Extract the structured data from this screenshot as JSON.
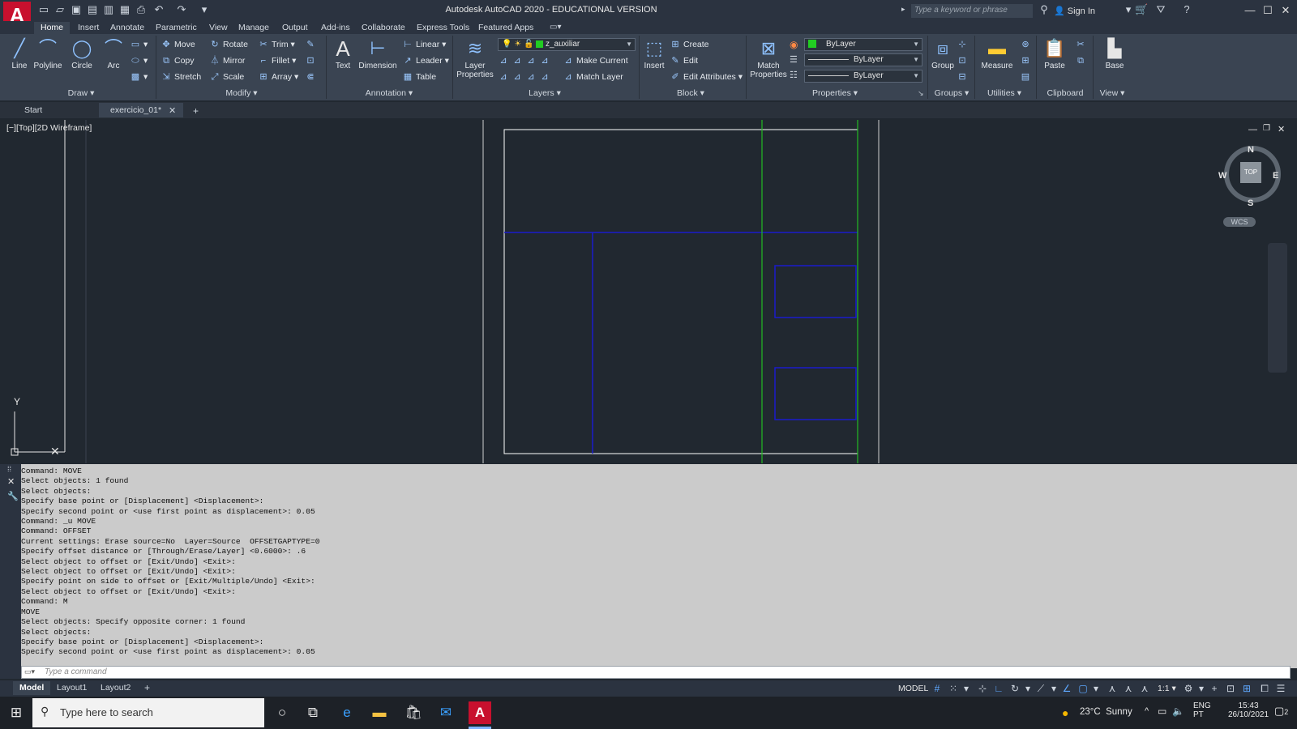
{
  "app": {
    "logo_letter": "A",
    "title": "Autodesk AutoCAD 2020 - EDUCATIONAL VERSION",
    "search_placeholder": "Type a keyword or phrase",
    "sign_in": "Sign In"
  },
  "ribbon_tabs": [
    "Home",
    "Insert",
    "Annotate",
    "Parametric",
    "View",
    "Manage",
    "Output",
    "Add-ins",
    "Collaborate",
    "Express Tools",
    "Featured Apps"
  ],
  "draw": {
    "label": "Draw",
    "line": "Line",
    "polyline": "Polyline",
    "circle": "Circle",
    "arc": "Arc"
  },
  "modify": {
    "label": "Modify",
    "move": "Move",
    "rotate": "Rotate",
    "trim": "Trim",
    "copy": "Copy",
    "mirror": "Mirror",
    "fillet": "Fillet",
    "stretch": "Stretch",
    "scale": "Scale",
    "array": "Array"
  },
  "annotation": {
    "label": "Annotation",
    "text": "Text",
    "dimension": "Dimension",
    "linear": "Linear",
    "leader": "Leader",
    "table": "Table"
  },
  "layers": {
    "label": "Layers",
    "layer_properties_1": "Layer",
    "layer_properties_2": "Properties",
    "current_layer": "z_auxiliar",
    "make_current": "Make Current",
    "match_layer": "Match Layer"
  },
  "block": {
    "label": "Block",
    "insert": "Insert",
    "create": "Create",
    "edit": "Edit",
    "edit_attributes": "Edit Attributes"
  },
  "properties": {
    "label": "Properties",
    "match_1": "Match",
    "match_2": "Properties",
    "color": "ByLayer",
    "linetype": "ByLayer",
    "lineweight": "ByLayer"
  },
  "groups": {
    "label": "Groups",
    "group": "Group"
  },
  "utilities": {
    "label": "Utilities",
    "measure": "Measure"
  },
  "clipboard": {
    "label": "Clipboard",
    "paste": "Paste"
  },
  "view": {
    "label": "View",
    "base": "Base"
  },
  "doc_tabs": {
    "start": "Start",
    "active": "exercicio_01*"
  },
  "viewport": {
    "label": "[−][Top][2D Wireframe]",
    "compass": {
      "n": "N",
      "s": "S",
      "e": "E",
      "w": "W",
      "top": "TOP"
    },
    "wcs": "WCS",
    "ucs_y": "Y"
  },
  "command_history": [
    "Command: MOVE",
    "Select objects: 1 found",
    "Select objects:",
    "Specify base point or [Displacement] <Displacement>:",
    "Specify second point or <use first point as displacement>: 0.05",
    "Command: _u MOVE",
    "Command: OFFSET",
    "Current settings: Erase source=No  Layer=Source  OFFSETGAPTYPE=0",
    "Specify offset distance or [Through/Erase/Layer] <0.6000>: .6",
    "Select object to offset or [Exit/Undo] <Exit>:",
    "Select object to offset or [Exit/Undo] <Exit>:",
    "Specify point on side to offset or [Exit/Multiple/Undo] <Exit>:",
    "Select object to offset or [Exit/Undo] <Exit>:",
    "Command: M",
    "MOVE",
    "Select objects: Specify opposite corner: 1 found",
    "Select objects:",
    "Specify base point or [Displacement] <Displacement>:",
    "Specify second point or <use first point as displacement>: 0.05"
  ],
  "command_placeholder": "Type a command",
  "layout_tabs": [
    "Model",
    "Layout1",
    "Layout2"
  ],
  "status": {
    "model": "MODEL",
    "scale": "1:1"
  },
  "taskbar": {
    "search": "Type here to search",
    "weather": "23°C  Sunny",
    "lang_1": "ENG",
    "lang_2": "PT",
    "time": "15:43",
    "date": "26/10/2021",
    "notifications": "2"
  },
  "colors": {
    "accent": "#c8102e",
    "layer_green": "#22cc22",
    "blue_lines": "#1a1acc",
    "green_lines": "#22bb22"
  }
}
